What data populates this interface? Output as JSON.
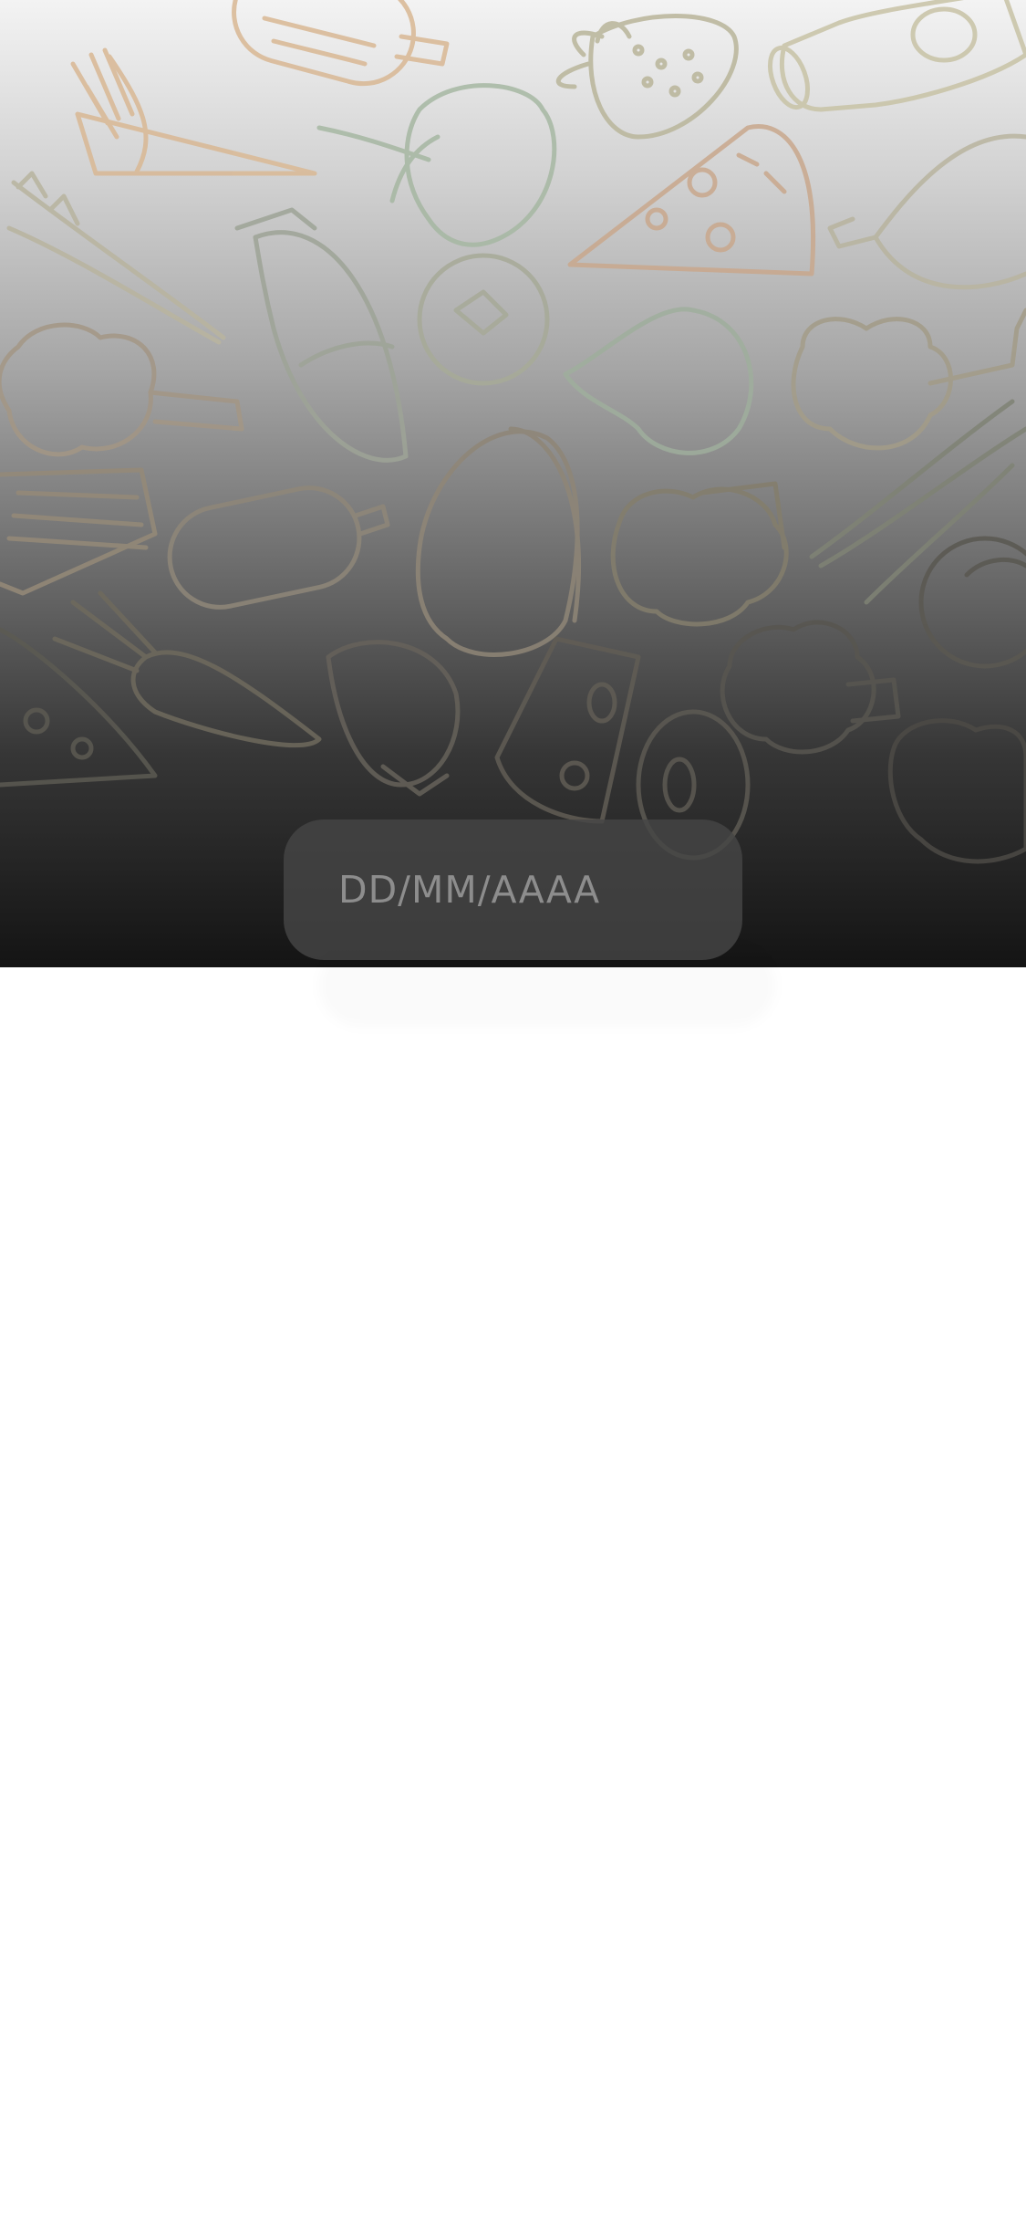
{
  "colors": {
    "background": "#ffffff",
    "hero_gradient_top": "#f3f3f3",
    "hero_gradient_bottom": "#141414",
    "field_background": "#464646",
    "placeholder_text": "#8d8d8d",
    "doodle_peach": "#d9b894",
    "doodle_green": "#9fb8a2"
  },
  "background_pattern": {
    "icons": [
      "fries-icon",
      "popsicle-icon",
      "strawberry-icon",
      "bottle-icon",
      "asparagus-icon",
      "apple-icon",
      "pizza-slice-icon",
      "drumstick-icon",
      "fish-icon",
      "tomato-icon",
      "garlic-icon",
      "broccoli-icon",
      "burger-icon",
      "carrot-icon",
      "cheese-icon",
      "donut-icon"
    ]
  },
  "date_input": {
    "placeholder": "DD/MM/AAAA",
    "value": ""
  }
}
